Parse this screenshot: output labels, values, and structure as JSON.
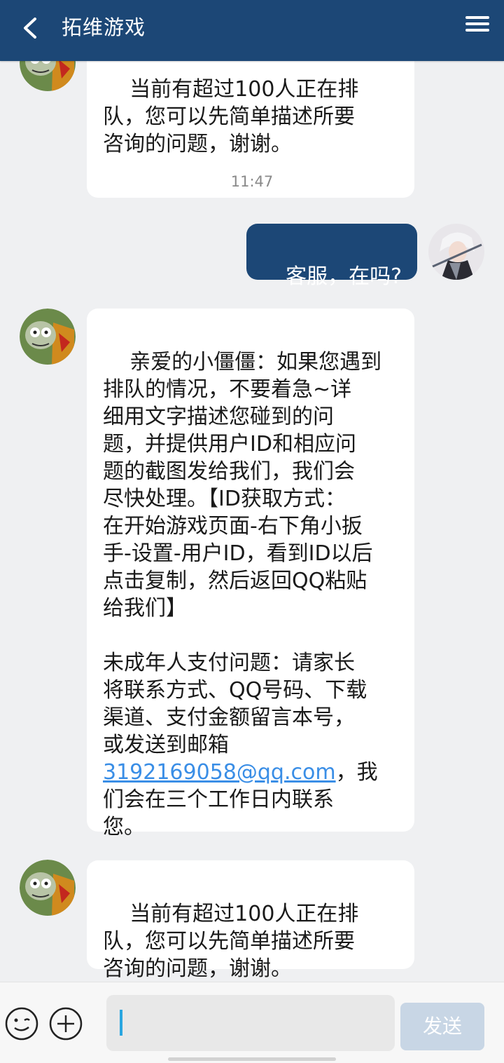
{
  "header": {
    "title": "拓维游戏"
  },
  "messages": [
    {
      "from": "bot",
      "text": "当前有超过100人正在排\n队，您可以先简单描述所要\n咨询的问题，谢谢。"
    },
    {
      "type": "timestamp",
      "text": "11:47"
    },
    {
      "from": "user",
      "text": "客服，在吗?"
    },
    {
      "from": "bot",
      "text_part1": "亲爱的小僵僵：如果您遇到\n排队的情况，不要着急~详\n细用文字描述您碰到的问\n题，并提供用户ID和相应问\n题的截图发给我们，我们会\n尽快处理。【ID获取方式：\n在开始游戏页面-右下角小扳\n手-设置-用户ID，看到ID以后\n点击复制，然后返回QQ粘贴\n给我们】\n\n未成年人支付问题：请家长\n将联系方式、QQ号码、下载\n渠道、支付金额留言本号，\n或发送到邮箱\n",
      "email": "3192169058@qq.com",
      "text_part2": "，我\n们会在三个工作日内联系\n您。"
    },
    {
      "from": "bot",
      "text": "当前有超过100人正在排\n队，您可以先简单描述所要\n咨询的问题，谢谢。"
    }
  ],
  "input": {
    "value": "",
    "send_label": "发送"
  },
  "colors": {
    "header_bg": "#1c4776",
    "user_bubble": "#1c4776",
    "link": "#3a8ee6",
    "send_disabled": "#c8d6e5"
  },
  "icons": [
    "back-icon",
    "menu-icon",
    "emoji-icon",
    "plus-icon"
  ]
}
